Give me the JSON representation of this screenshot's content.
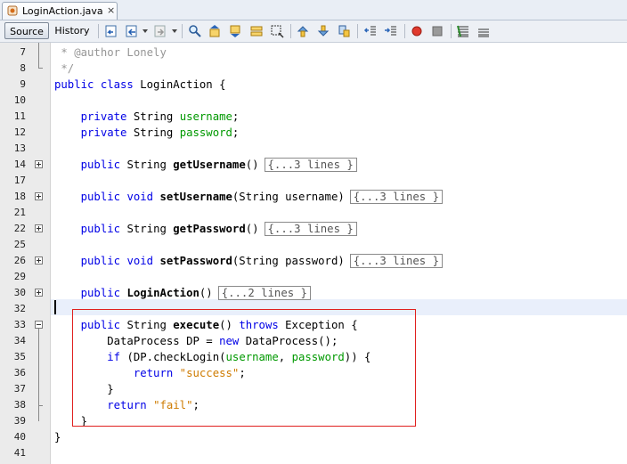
{
  "tab": {
    "title": "LoginAction.java",
    "close": "×"
  },
  "toolbar": {
    "source": "Source",
    "history": "History"
  },
  "lines": [
    {
      "num": "7",
      "parts": [
        [
          "cmt",
          " * @author Lonely"
        ]
      ]
    },
    {
      "num": "8",
      "parts": [
        [
          "cmt",
          " */"
        ]
      ]
    },
    {
      "num": "9",
      "parts": [
        [
          "kw",
          "public class "
        ],
        [
          "",
          "LoginAction {"
        ]
      ]
    },
    {
      "num": "10",
      "parts": []
    },
    {
      "num": "11",
      "parts": [
        [
          "",
          "    "
        ],
        [
          "kw",
          "private "
        ],
        [
          "",
          "String "
        ],
        [
          "fld",
          "username"
        ],
        [
          "",
          ";"
        ]
      ]
    },
    {
      "num": "12",
      "parts": [
        [
          "",
          "    "
        ],
        [
          "kw",
          "private "
        ],
        [
          "",
          "String "
        ],
        [
          "fld",
          "password"
        ],
        [
          "",
          ";"
        ]
      ]
    },
    {
      "num": "13",
      "parts": []
    },
    {
      "num": "14",
      "parts": [
        [
          "",
          "    "
        ],
        [
          "kw",
          "public "
        ],
        [
          "",
          "String "
        ],
        [
          "fn",
          "getUsername"
        ],
        [
          "",
          "()"
        ],
        [
          "fcol",
          "{...3 lines }"
        ]
      ]
    },
    {
      "num": "17",
      "parts": []
    },
    {
      "num": "18",
      "parts": [
        [
          "",
          "    "
        ],
        [
          "kw",
          "public void "
        ],
        [
          "fn",
          "setUsername"
        ],
        [
          "",
          "(String username)"
        ],
        [
          "fcol",
          "{...3 lines }"
        ]
      ]
    },
    {
      "num": "21",
      "parts": []
    },
    {
      "num": "22",
      "parts": [
        [
          "",
          "    "
        ],
        [
          "kw",
          "public "
        ],
        [
          "",
          "String "
        ],
        [
          "fn",
          "getPassword"
        ],
        [
          "",
          "()"
        ],
        [
          "fcol",
          "{...3 lines }"
        ]
      ]
    },
    {
      "num": "25",
      "parts": []
    },
    {
      "num": "26",
      "parts": [
        [
          "",
          "    "
        ],
        [
          "kw",
          "public void "
        ],
        [
          "fn",
          "setPassword"
        ],
        [
          "",
          "(String password)"
        ],
        [
          "fcol",
          "{...3 lines }"
        ]
      ]
    },
    {
      "num": "29",
      "parts": []
    },
    {
      "num": "30",
      "parts": [
        [
          "",
          "    "
        ],
        [
          "kw",
          "public "
        ],
        [
          "fn",
          "LoginAction"
        ],
        [
          "",
          "()"
        ],
        [
          "fcol",
          "{...2 lines }"
        ]
      ]
    },
    {
      "num": "32",
      "parts": []
    },
    {
      "num": "33",
      "parts": [
        [
          "",
          "    "
        ],
        [
          "kw",
          "public "
        ],
        [
          "",
          "String "
        ],
        [
          "fn",
          "execute"
        ],
        [
          "",
          "() "
        ],
        [
          "kw",
          "throws "
        ],
        [
          "",
          "Exception {"
        ]
      ]
    },
    {
      "num": "34",
      "parts": [
        [
          "",
          "        DataProcess DP = "
        ],
        [
          "kw",
          "new "
        ],
        [
          "",
          "DataProcess();"
        ]
      ]
    },
    {
      "num": "35",
      "parts": [
        [
          "",
          "        "
        ],
        [
          "kw",
          "if "
        ],
        [
          "",
          "(DP.checkLogin("
        ],
        [
          "fld",
          "username"
        ],
        [
          "",
          ", "
        ],
        [
          "fld",
          "password"
        ],
        [
          "",
          "))"
        ],
        [
          "",
          " {"
        ]
      ]
    },
    {
      "num": "36",
      "parts": [
        [
          "",
          "            "
        ],
        [
          "kw",
          "return "
        ],
        [
          "str",
          "\"success\""
        ],
        [
          "",
          ";"
        ]
      ]
    },
    {
      "num": "37",
      "parts": [
        [
          "",
          "        }"
        ]
      ]
    },
    {
      "num": "38",
      "parts": [
        [
          "",
          "        "
        ],
        [
          "kw",
          "return "
        ],
        [
          "str",
          "\"fail\""
        ],
        [
          "",
          ";"
        ]
      ]
    },
    {
      "num": "39",
      "parts": [
        [
          "",
          "    }"
        ]
      ]
    },
    {
      "num": "40",
      "parts": [
        [
          "",
          "}"
        ]
      ]
    },
    {
      "num": "41",
      "parts": []
    }
  ]
}
